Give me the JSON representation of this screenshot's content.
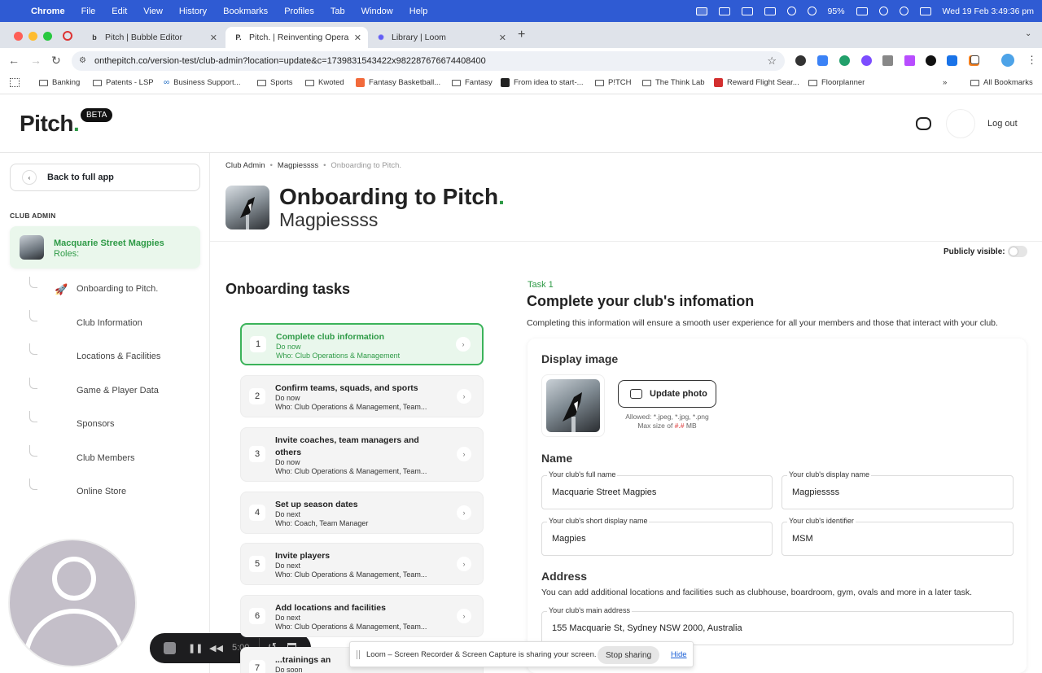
{
  "menubar": {
    "app": "Chrome",
    "items": [
      "File",
      "Edit",
      "View",
      "History",
      "Bookmarks",
      "Profiles",
      "Tab",
      "Window",
      "Help"
    ],
    "battery": "95%",
    "clock": "Wed 19 Feb  3:49:36 pm"
  },
  "tabs": [
    {
      "label": "Pitch | Bubble Editor",
      "fav": "b"
    },
    {
      "label": "Pitch. | Reinventing Opera",
      "fav": "P."
    },
    {
      "label": "Library | Loom",
      "fav": "✺"
    }
  ],
  "address": {
    "url": "onthepitch.co/version-test/club-admin?location=update&c=1739831543422x982287676674408400"
  },
  "bookmarks": [
    "Banking",
    "Patents - LSP",
    "Business Support...",
    "Sports",
    "Kwoted",
    "Fantasy Basketball...",
    "Fantasy",
    "From idea to start-...",
    "P!TCH",
    "The Think Lab",
    "Reward Flight Sear...",
    "Floorplanner"
  ],
  "bookmarks_more": "»",
  "all_bookmarks": "All Bookmarks",
  "header": {
    "logo": "Pitch",
    "logo_dot": ".",
    "beta": "BETA",
    "logout": "Log out"
  },
  "sidebar": {
    "back": "Back to full app",
    "section": "CLUB ADMIN",
    "club_name": "Macquarie Street Magpies",
    "club_roles": "Roles:",
    "items": [
      "Onboarding to Pitch.",
      "Club Information",
      "Locations & Facilities",
      "Game & Player Data",
      "Sponsors",
      "Club Members",
      "Online Store"
    ]
  },
  "breadcrumb": [
    "Club Admin",
    "Magpiessss",
    "Onboarding to Pitch."
  ],
  "page": {
    "title": "Onboarding to Pitch",
    "title_dot": ".",
    "subtitle": "Magpiessss",
    "public_label": "Publicly visible:",
    "tasks_heading": "Onboarding tasks"
  },
  "tasks": [
    {
      "num": "1",
      "title": "Complete club information",
      "status": "Do now",
      "who": "Who:  Club Operations & Management"
    },
    {
      "num": "2",
      "title": "Confirm teams, squads, and sports",
      "status": "Do now",
      "who": "Who:  Club Operations & Management, Team..."
    },
    {
      "num": "3",
      "title": "Invite coaches, team managers and others",
      "status": "Do now",
      "who": "Who:  Club Operations & Management, Team..."
    },
    {
      "num": "4",
      "title": "Set up season dates",
      "status": "Do next",
      "who": "Who:  Coach, Team Manager"
    },
    {
      "num": "5",
      "title": "Invite players",
      "status": "Do next",
      "who": "Who:  Club Operations & Management, Team..."
    },
    {
      "num": "6",
      "title": "Add locations and facilities",
      "status": "Do next",
      "who": "Who:  Club Operations & Management, Team..."
    },
    {
      "num": "7",
      "title": "...trainings an",
      "status": "Do soon",
      "who": ""
    }
  ],
  "task_detail": {
    "label": "Task 1",
    "title": "Complete your club's infomation",
    "desc": "Completing this information will ensure a smooth user experience for all your members and those that interact with your club.",
    "display_image": "Display image",
    "update_photo": "Update photo",
    "allowed": "Allowed:  *.jpeg,  *.jpg,  *.png",
    "max_prefix": "Max size of ",
    "max_val": "#.#",
    "max_suffix": " MB",
    "name_heading": "Name",
    "fields": [
      {
        "label": "Your club's full name",
        "value": "Macquarie Street Magpies"
      },
      {
        "label": "Your club's display name",
        "value": "Magpiessss"
      },
      {
        "label": "Your club's short display name",
        "value": "Magpies"
      },
      {
        "label": "Your club's identifier",
        "value": "MSM"
      }
    ],
    "address_heading": "Address",
    "address_desc": "You can add additional locations and facilities such as clubhouse, boardroom, gym, ovals and more in a later task.",
    "address_label": "Your club's main address",
    "address_value": "155 Macquarie St, Sydney NSW 2000, Australia"
  },
  "loom": {
    "timer": "5:00",
    "share_text": "Loom – Screen Recorder & Screen Capture is sharing your screen.",
    "stop": "Stop sharing",
    "hide": "Hide"
  },
  "colors": {
    "accent": "#2e9a46",
    "menubar": "#2f5bd3"
  }
}
